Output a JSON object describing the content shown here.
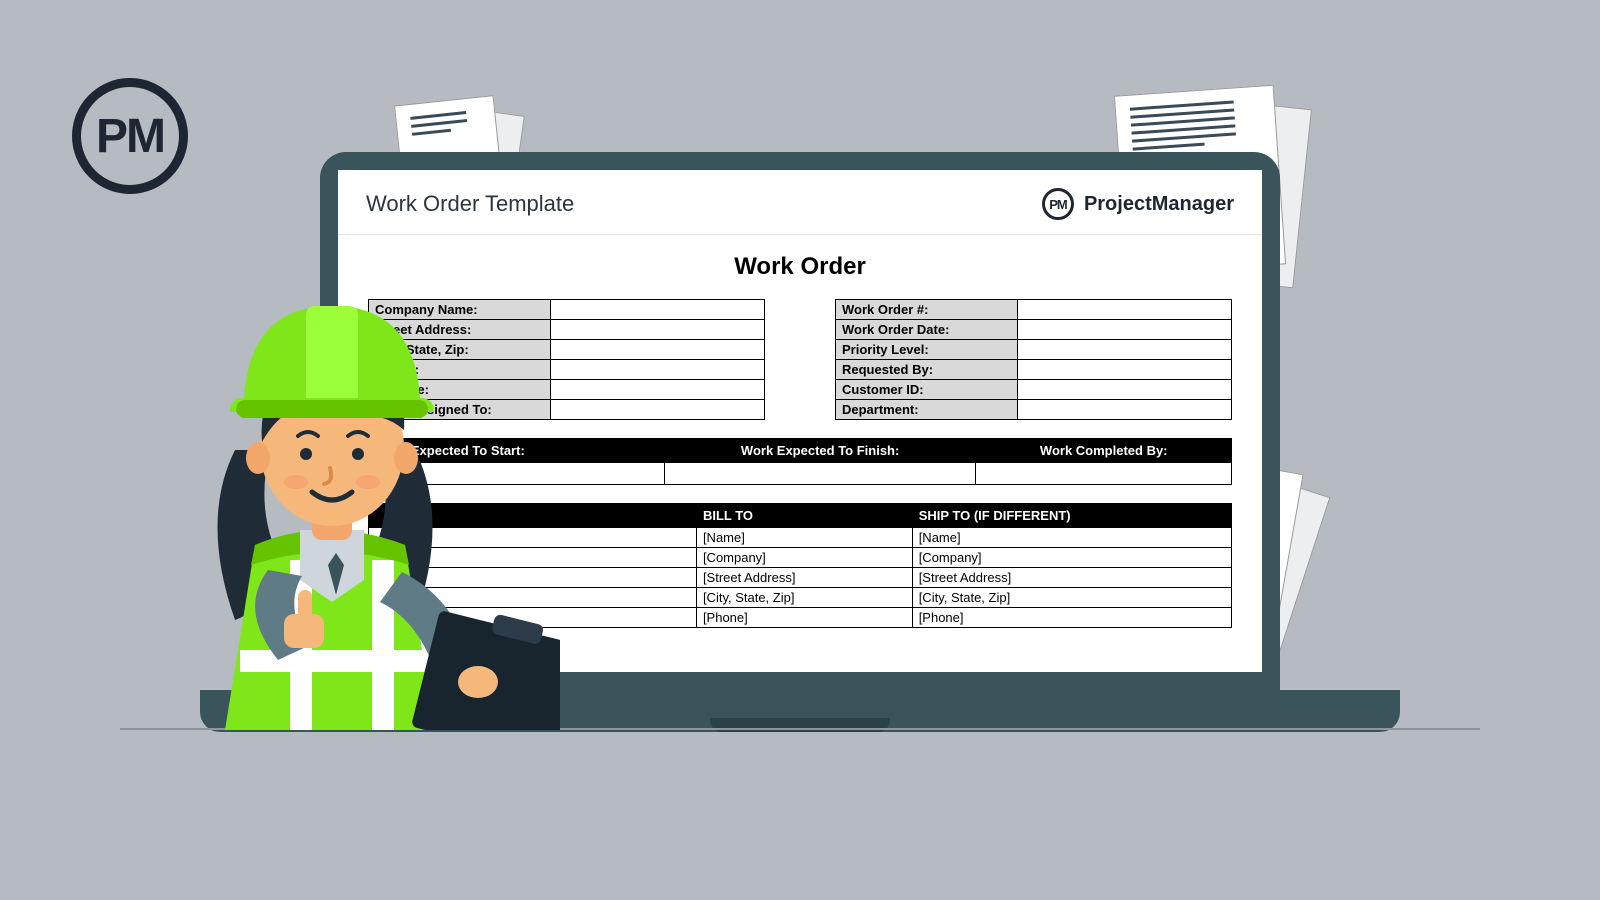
{
  "logo_text": "PM",
  "screen": {
    "header_title": "Work Order Template",
    "brand_badge": "PM",
    "brand_name": "ProjectManager"
  },
  "doc": {
    "title": "Work Order",
    "left_fields": [
      "Company Name:",
      "Street Address:",
      "City, State, Zip:",
      "Phone:",
      "Website:",
      "Work Assigned To:"
    ],
    "right_fields": [
      "Work Order #:",
      "Work Order Date:",
      "Priority Level:",
      "Requested By:",
      "Customer ID:",
      "Department:"
    ],
    "date_headers": [
      "Work Expected To Start:",
      "Work Expected To Finish:",
      "Work Completed By:"
    ],
    "billship_headers": {
      "blank": "",
      "bill": "BILL TO",
      "ship": "SHIP TO (IF DIFFERENT)"
    },
    "billship_rows": [
      {
        "bill": "[Name]",
        "ship": "[Name]"
      },
      {
        "bill": "[Company]",
        "ship": "[Company]"
      },
      {
        "bill": "[Street Address]",
        "ship": "[Street Address]"
      },
      {
        "bill": "[City, State, Zip]",
        "ship": "[City, State, Zip]"
      },
      {
        "bill": "[Phone]",
        "ship": "[Phone]"
      }
    ]
  }
}
